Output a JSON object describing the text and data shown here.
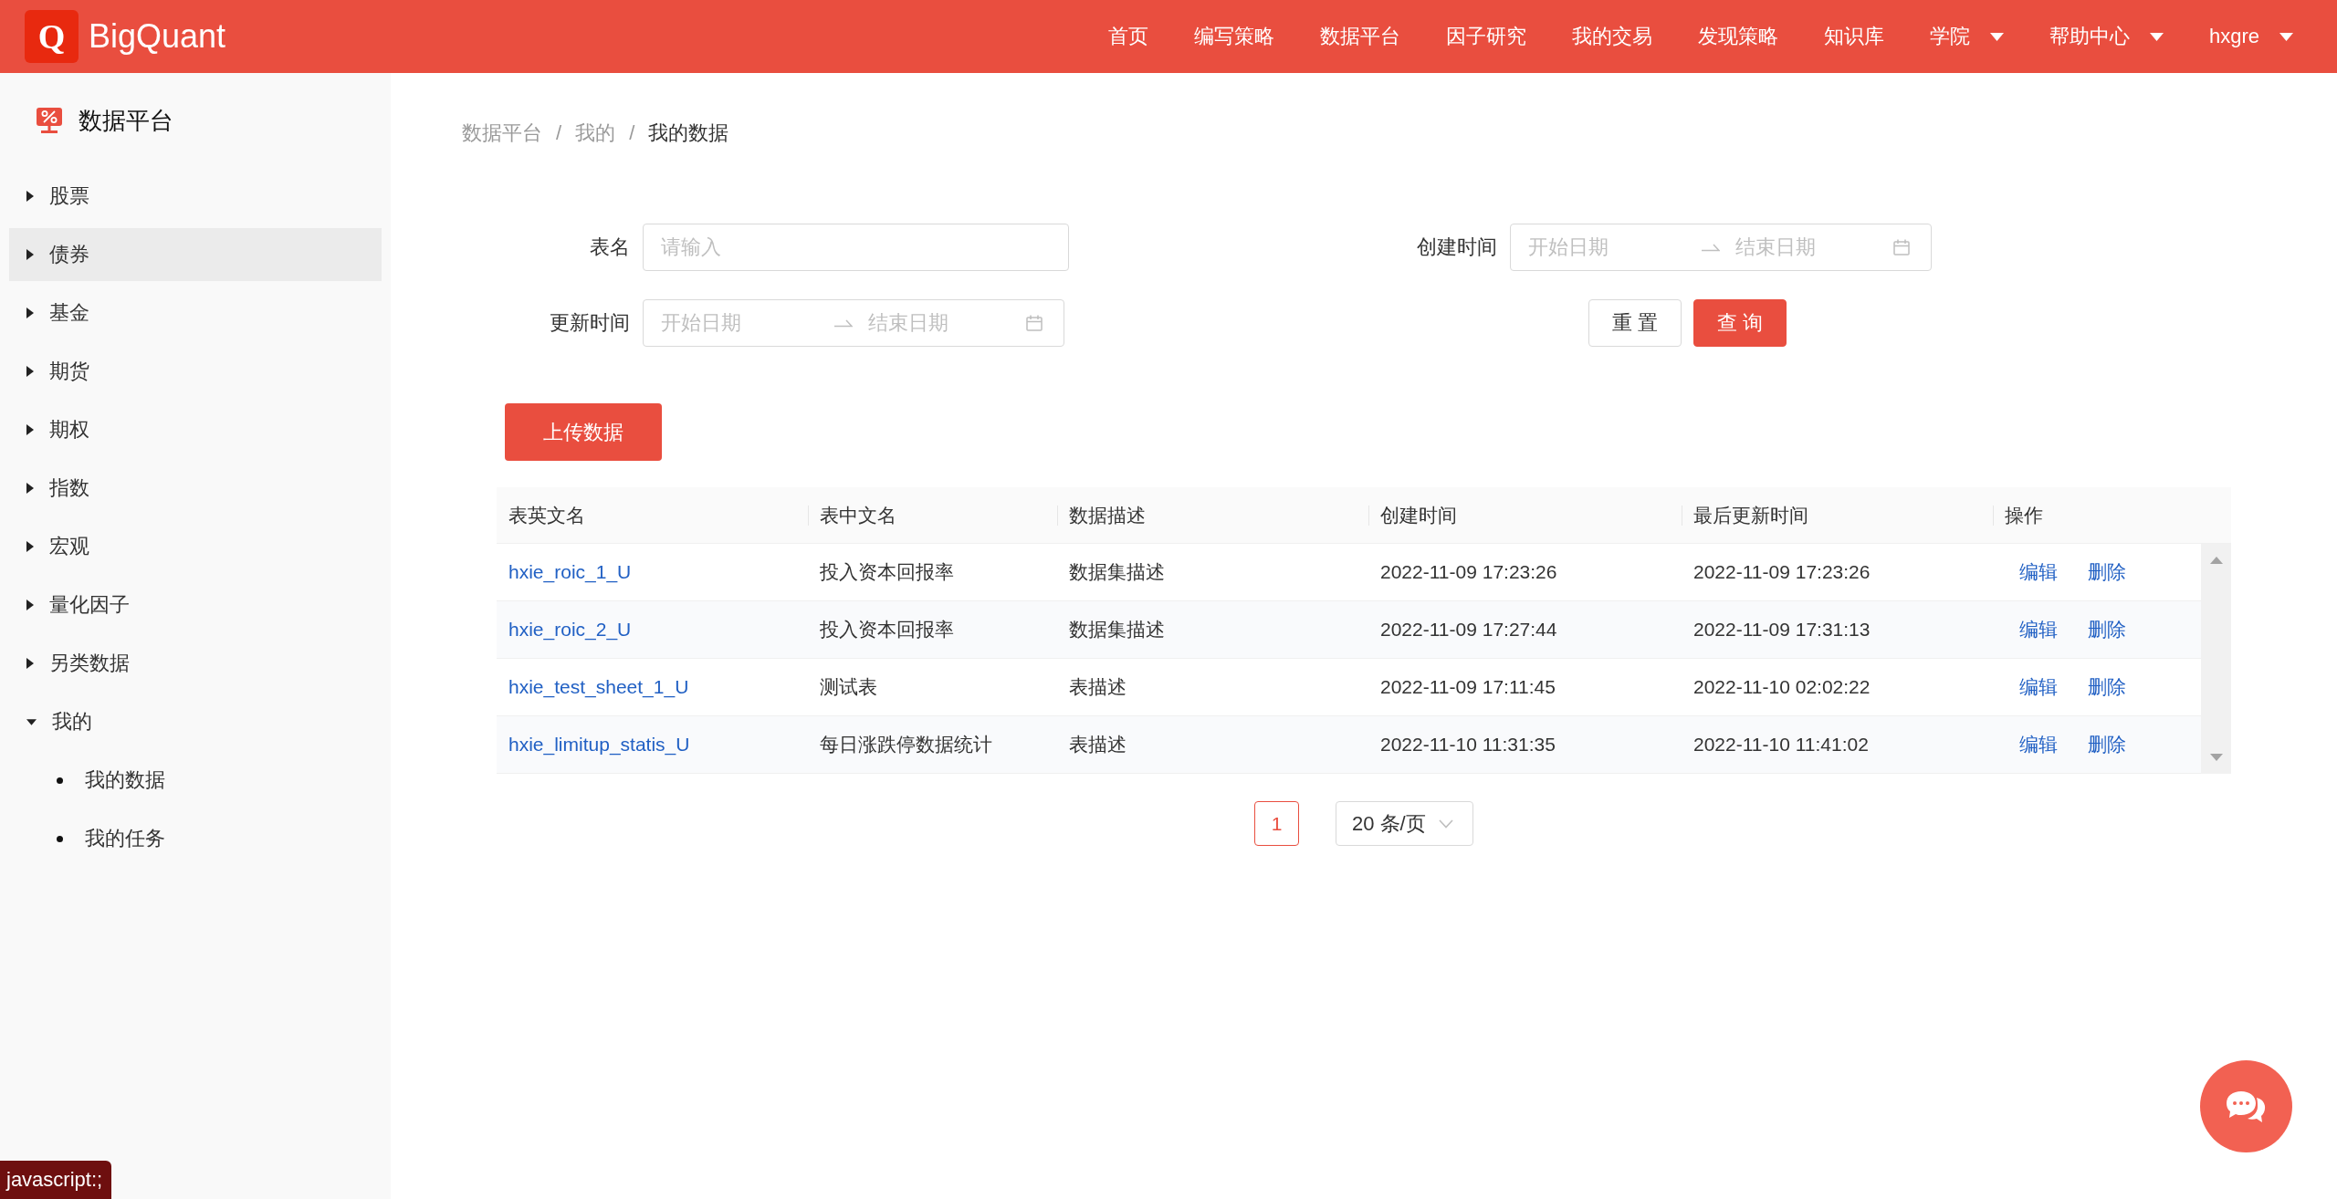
{
  "header": {
    "logo": {
      "mark": "Q",
      "name": "BigQuant"
    },
    "nav": [
      {
        "label": "首页",
        "dropdown": false
      },
      {
        "label": "编写策略",
        "dropdown": false
      },
      {
        "label": "数据平台",
        "dropdown": false
      },
      {
        "label": "因子研究",
        "dropdown": false
      },
      {
        "label": "我的交易",
        "dropdown": false
      },
      {
        "label": "发现策略",
        "dropdown": false
      },
      {
        "label": "知识库",
        "dropdown": false
      },
      {
        "label": "学院",
        "dropdown": true
      },
      {
        "label": "帮助中心",
        "dropdown": true
      },
      {
        "label": "hxgre",
        "dropdown": true
      }
    ]
  },
  "sidebar": {
    "title": "数据平台",
    "items": [
      {
        "label": "股票",
        "expanded": false,
        "hovered": false
      },
      {
        "label": "债券",
        "expanded": false,
        "hovered": true
      },
      {
        "label": "基金",
        "expanded": false,
        "hovered": false
      },
      {
        "label": "期货",
        "expanded": false,
        "hovered": false
      },
      {
        "label": "期权",
        "expanded": false,
        "hovered": false
      },
      {
        "label": "指数",
        "expanded": false,
        "hovered": false
      },
      {
        "label": "宏观",
        "expanded": false,
        "hovered": false
      },
      {
        "label": "量化因子",
        "expanded": false,
        "hovered": false
      },
      {
        "label": "另类数据",
        "expanded": false,
        "hovered": false
      },
      {
        "label": "我的",
        "expanded": true,
        "hovered": false,
        "children": [
          {
            "label": "我的数据"
          },
          {
            "label": "我的任务"
          }
        ]
      }
    ]
  },
  "breadcrumb": {
    "items": [
      {
        "label": "数据平台",
        "current": false
      },
      {
        "label": "我的",
        "current": false
      },
      {
        "label": "我的数据",
        "current": true
      }
    ],
    "separators": [
      "/",
      "/"
    ]
  },
  "filters": {
    "table_name": {
      "label": "表名",
      "placeholder": "请输入"
    },
    "created_time": {
      "label": "创建时间",
      "start_placeholder": "开始日期",
      "end_placeholder": "结束日期"
    },
    "updated_time": {
      "label": "更新时间",
      "start_placeholder": "开始日期",
      "end_placeholder": "结束日期"
    },
    "buttons": [
      {
        "label": "重 置",
        "kind": "default"
      },
      {
        "label": "查 询",
        "kind": "primary"
      }
    ]
  },
  "upload_button": {
    "label": "上传数据"
  },
  "table": {
    "columns": [
      "表英文名",
      "表中文名",
      "数据描述",
      "创建时间",
      "最后更新时间",
      "操作"
    ],
    "rows": [
      {
        "english_name": "hxie_roic_1_U",
        "chinese_name": "投入资本回报率",
        "description": "数据集描述",
        "created": "2022-11-09 17:23:26",
        "updated": "2022-11-09 17:23:26",
        "actions": [
          "编辑",
          "删除"
        ]
      },
      {
        "english_name": "hxie_roic_2_U",
        "chinese_name": "投入资本回报率",
        "description": "数据集描述",
        "created": "2022-11-09 17:27:44",
        "updated": "2022-11-09 17:31:13",
        "actions": [
          "编辑",
          "删除"
        ]
      },
      {
        "english_name": "hxie_test_sheet_1_U",
        "chinese_name": "测试表",
        "description": "表描述",
        "created": "2022-11-09 17:11:45",
        "updated": "2022-11-10 02:02:22",
        "actions": [
          "编辑",
          "删除"
        ]
      },
      {
        "english_name": "hxie_limitup_statis_U",
        "chinese_name": "每日涨跌停数据统计",
        "description": "表描述",
        "created": "2022-11-10 11:31:35",
        "updated": "2022-11-10 11:41:02",
        "actions": [
          "编辑",
          "删除"
        ]
      }
    ]
  },
  "pagination": {
    "pages": [
      {
        "label": "1",
        "selected": true
      }
    ],
    "page_size": "20 条/页"
  },
  "status_bar": {
    "text": "javascript:;"
  }
}
